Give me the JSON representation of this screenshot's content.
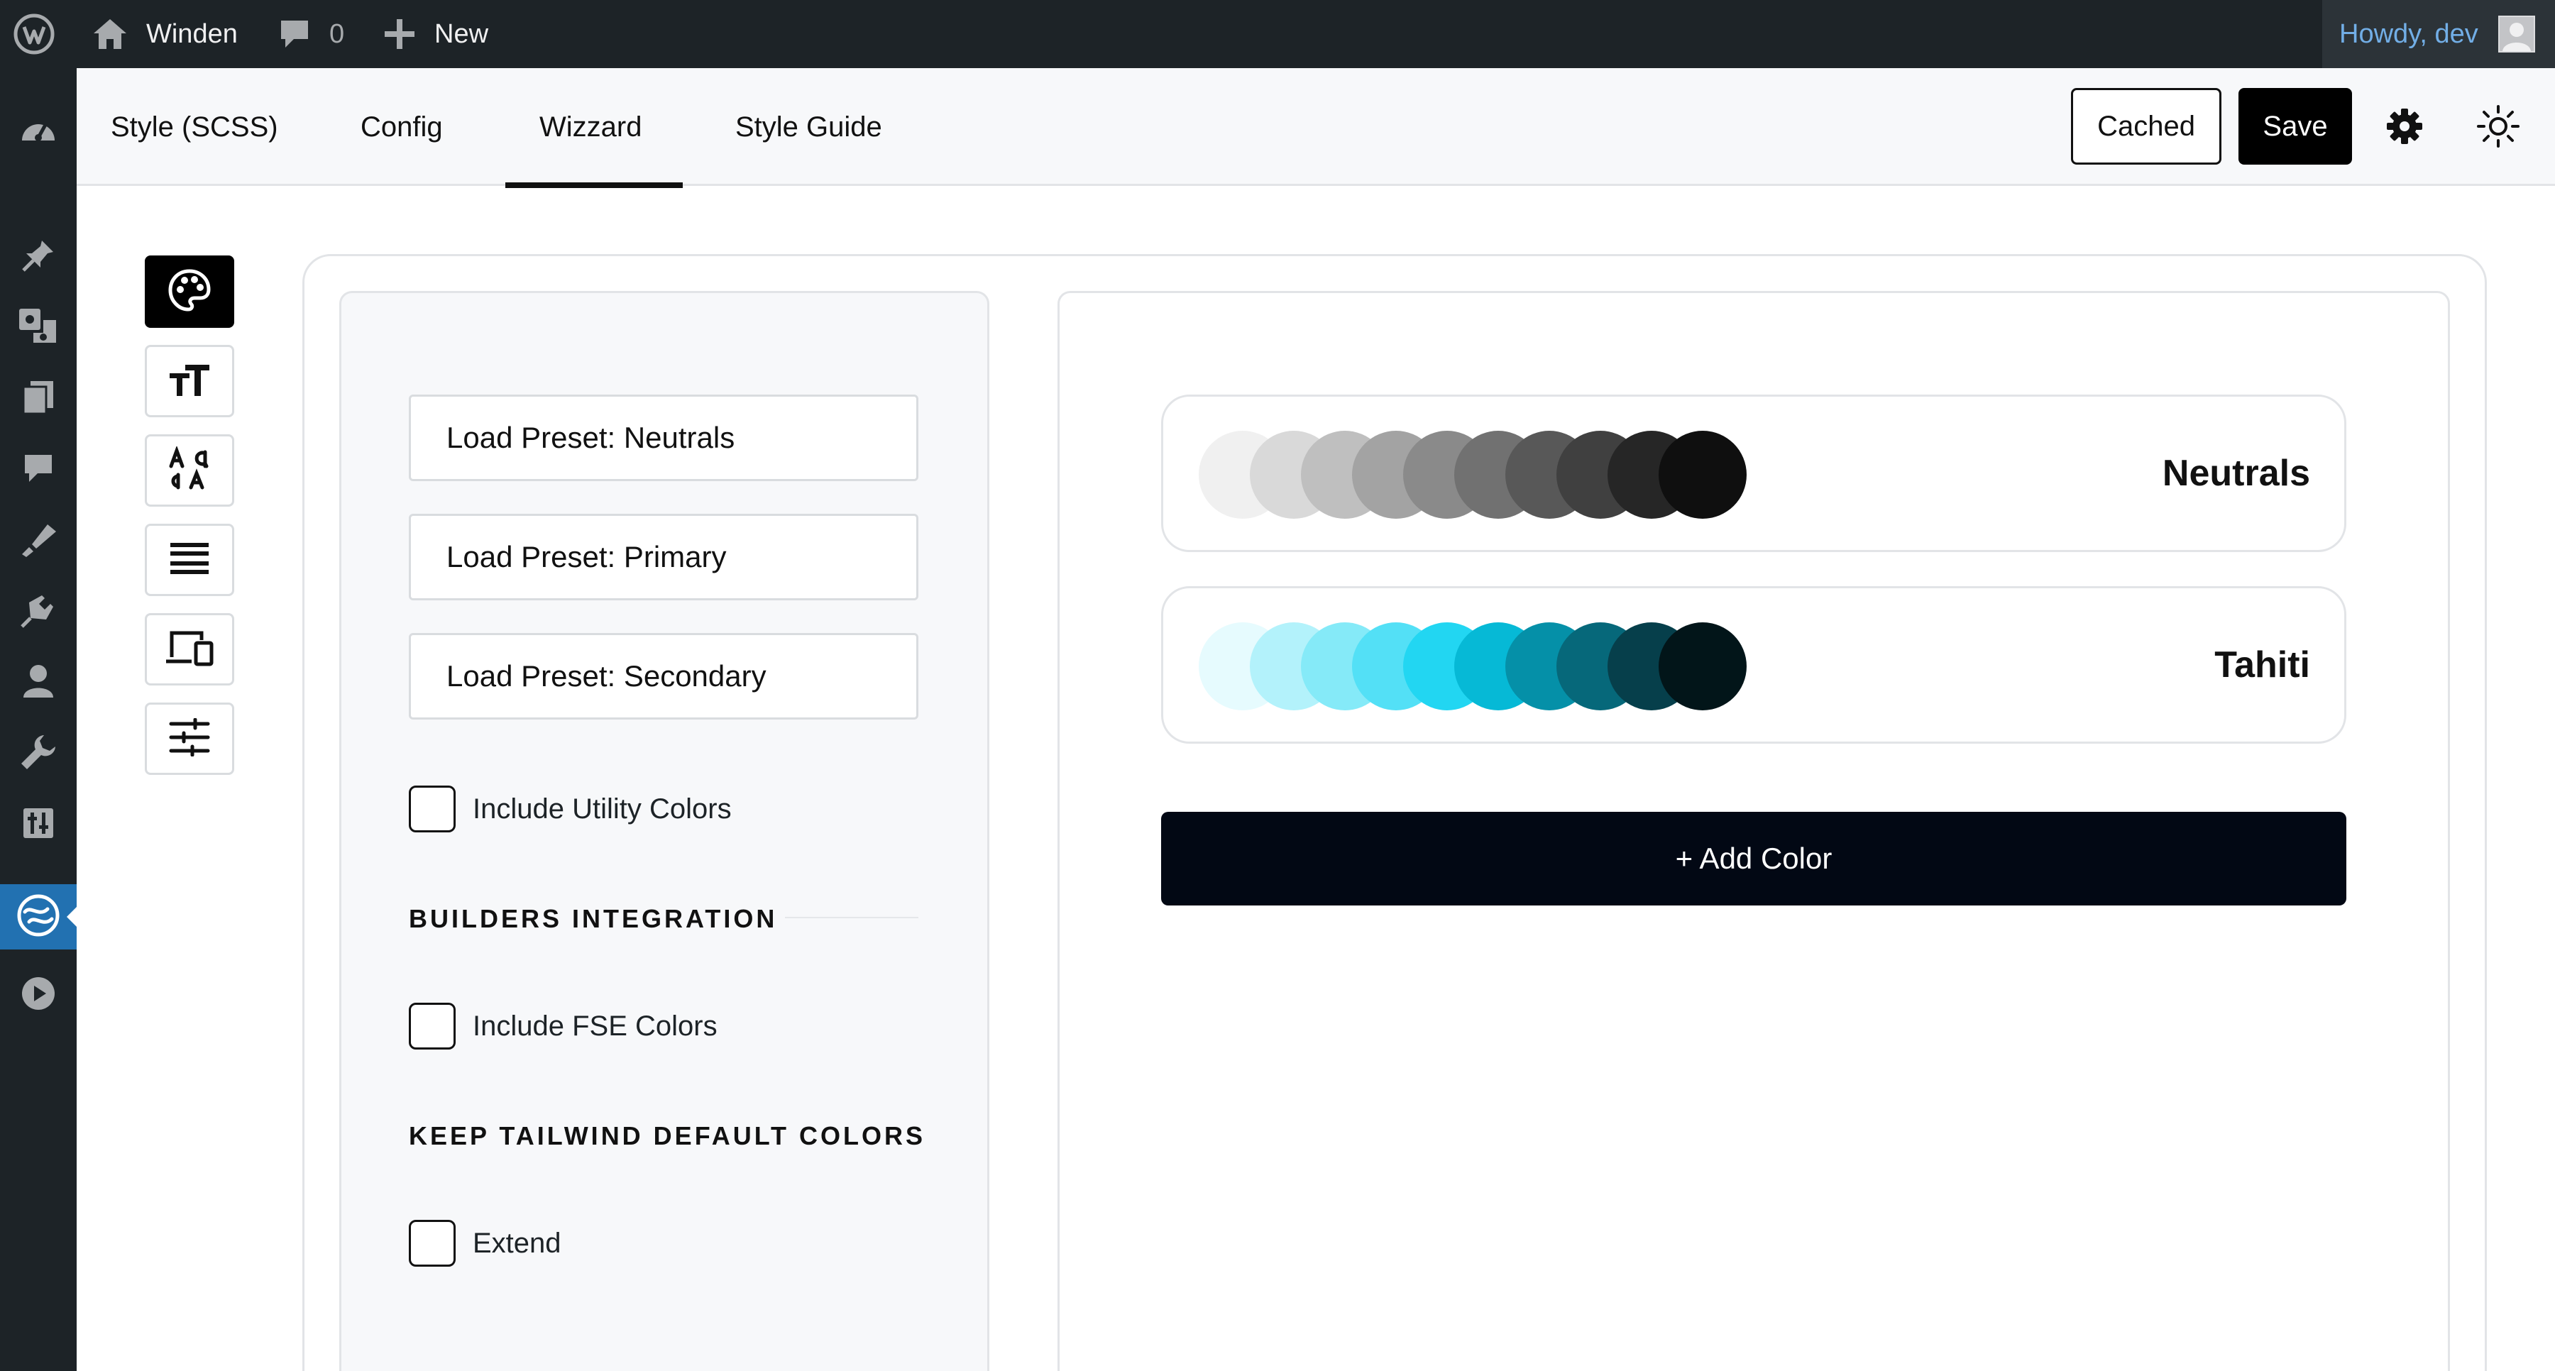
{
  "admin_bar": {
    "site_name": "Winden",
    "comments_count": "0",
    "new_label": "New",
    "howdy": "Howdy, dev"
  },
  "admin_menu": {
    "icons": [
      "dashboard-icon",
      "pin-icon",
      "media-icon",
      "pages-icon",
      "comments-icon",
      "appearance-icon",
      "plugins-icon",
      "users-icon",
      "tools-icon",
      "settings-icon",
      "winden-icon",
      "play-icon"
    ],
    "active": "winden-icon",
    "active_color": "#2271b1"
  },
  "header": {
    "tabs": [
      {
        "label": "Style (SCSS)"
      },
      {
        "label": "Config"
      },
      {
        "label": "Wizzard"
      },
      {
        "label": "Style Guide"
      }
    ],
    "active_tab": "Wizzard",
    "cached_label": "Cached",
    "save_label": "Save"
  },
  "toolbar": {
    "tools": [
      "palette-icon",
      "text-size-icon",
      "font-family-icon",
      "spacing-icon",
      "devices-icon",
      "sliders-icon"
    ],
    "active": "palette-icon"
  },
  "settings": {
    "presets": [
      {
        "label": "Load Preset: Neutrals"
      },
      {
        "label": "Load Preset: Primary"
      },
      {
        "label": "Load Preset: Secondary"
      }
    ],
    "utility_colors": {
      "label": "Include Utility Colors",
      "checked": false
    },
    "builders_heading": "BUILDERS INTEGRATION",
    "fse_colors": {
      "label": "Include FSE Colors",
      "checked": false
    },
    "tailwind_heading": "KEEP TAILWIND DEFAULT COLORS",
    "extend": {
      "label": "Extend",
      "checked": false
    }
  },
  "palettes": [
    {
      "name": "Neutrals",
      "swatches": [
        "#f0f0f0",
        "#d9d9d9",
        "#bfbfbf",
        "#a3a3a3",
        "#8a8a8a",
        "#717171",
        "#585858",
        "#404040",
        "#262626",
        "#0f0f0f"
      ]
    },
    {
      "name": "Tahiti",
      "swatches": [
        "#e6fbfe",
        "#b3f2fb",
        "#85eaf8",
        "#53e0f6",
        "#22d6f2",
        "#06b9d6",
        "#0590a8",
        "#06687a",
        "#063f4b",
        "#021519"
      ]
    }
  ],
  "add_color_label": "+ Add Color"
}
